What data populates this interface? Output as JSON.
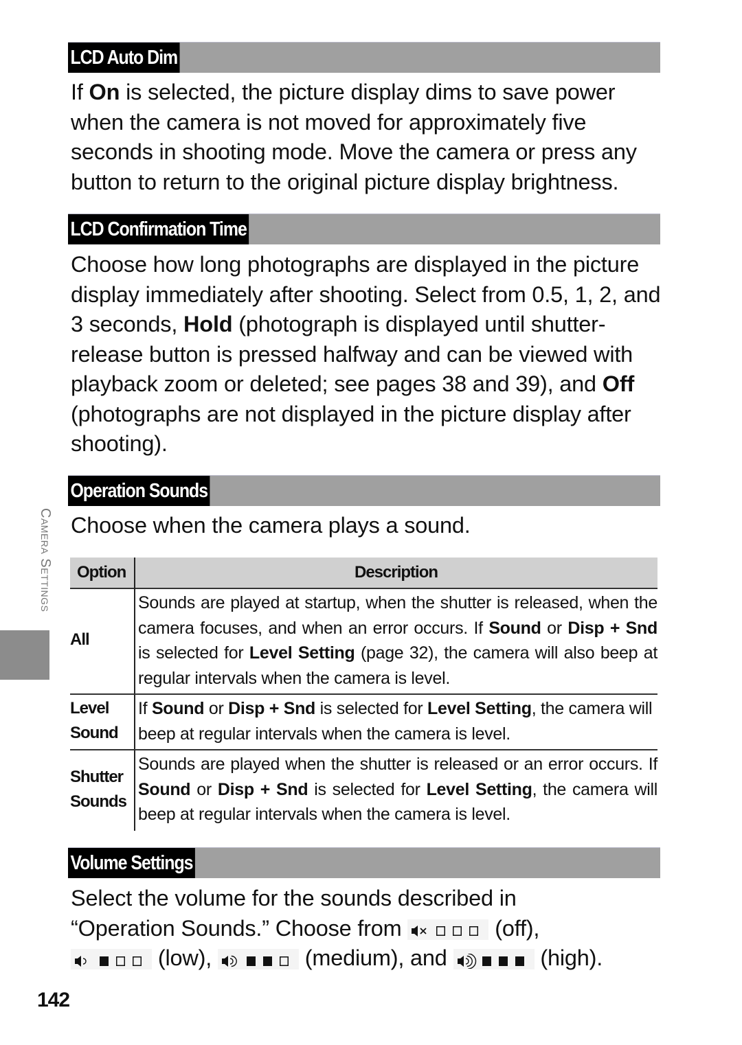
{
  "sections": [
    {
      "heading": "LCD Auto Dim",
      "body_parts": [
        {
          "text": "If ",
          "bold": false
        },
        {
          "text": "On",
          "bold": true
        },
        {
          "text": " is selected, the picture display dims to save power when the camera is not moved for approximately five seconds in shooting mode. Move the camera or press any button to return to the original picture display brightness.",
          "bold": false
        }
      ]
    },
    {
      "heading": "LCD Confirmation Time",
      "body_parts": [
        {
          "text": "Choose how long photographs are displayed in the picture display immediately after shooting. Select from 0.5, 1, 2, and 3 seconds, ",
          "bold": false
        },
        {
          "text": "Hold",
          "bold": true
        },
        {
          "text": " (photograph is displayed until shutter-release button is pressed halfway and can be viewed with playback zoom or deleted; see pages 38 and 39), and ",
          "bold": false
        },
        {
          "text": "Off",
          "bold": true
        },
        {
          "text": " (photographs are not displayed in the picture display after shooting).",
          "bold": false
        }
      ]
    },
    {
      "heading": "Operation Sounds",
      "body_parts": [
        {
          "text": "Choose when the camera plays a sound.",
          "bold": false
        }
      ]
    },
    {
      "heading": "Volume Settings",
      "line1": "Select the volume for the sounds described in",
      "line2_prefix": "“Operation Sounds.” Choose from",
      "levels": [
        {
          "icon": "speaker-muted-icon",
          "filled_bars": 0,
          "total_bars": 3,
          "label": "(off),"
        },
        {
          "icon": "speaker-low-icon",
          "filled_bars": 1,
          "total_bars": 3,
          "label": "(low),"
        },
        {
          "icon": "speaker-medium-icon",
          "filled_bars": 2,
          "total_bars": 3,
          "label": "(medium), and"
        },
        {
          "icon": "speaker-high-icon",
          "filled_bars": 3,
          "total_bars": 3,
          "label": "(high)."
        }
      ]
    }
  ],
  "table": {
    "headers": [
      "Option",
      "Description"
    ],
    "rows": [
      {
        "option": "All",
        "description_parts": [
          {
            "text": "Sounds are played at startup, when the shutter is released, when the camera focuses, and when an error occurs. If ",
            "bold": false
          },
          {
            "text": "Sound",
            "bold": true
          },
          {
            "text": " or ",
            "bold": false
          },
          {
            "text": "Disp + Snd",
            "bold": true
          },
          {
            "text": " is selected for ",
            "bold": false
          },
          {
            "text": "Level Setting",
            "bold": true
          },
          {
            "text": " (page 32), the camera will also beep at regular intervals when the camera is level.",
            "bold": false
          }
        ]
      },
      {
        "option": "Level Sound",
        "description_parts": [
          {
            "text": "If ",
            "bold": false
          },
          {
            "text": "Sound",
            "bold": true
          },
          {
            "text": " or ",
            "bold": false
          },
          {
            "text": "Disp + Snd",
            "bold": true
          },
          {
            "text": " is selected for ",
            "bold": false
          },
          {
            "text": "Level Setting",
            "bold": true
          },
          {
            "text": ", the camera will beep at regular intervals when the camera is level.",
            "bold": false
          }
        ]
      },
      {
        "option": "Shutter Sounds",
        "description_parts": [
          {
            "text": "Sounds are played when the shutter is released or an error occurs. If ",
            "bold": false
          },
          {
            "text": "Sound",
            "bold": true
          },
          {
            "text": " or ",
            "bold": false
          },
          {
            "text": "Disp + Snd",
            "bold": true
          },
          {
            "text": " is selected for ",
            "bold": false
          },
          {
            "text": "Level Setting",
            "bold": true
          },
          {
            "text": ", the camera will beep at regular intervals when the camera is level.",
            "bold": false
          }
        ]
      }
    ]
  },
  "side_tab": {
    "label": "Camera Settings"
  },
  "page_number": "142"
}
